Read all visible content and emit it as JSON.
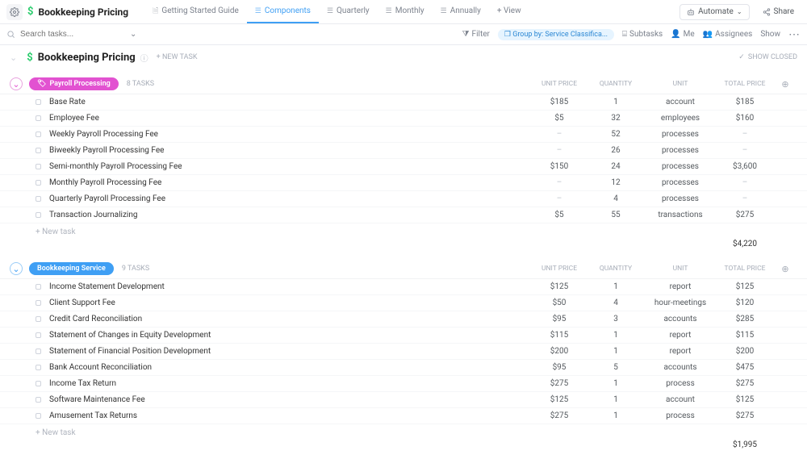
{
  "header": {
    "title": "Bookkeeping Pricing",
    "tabs": [
      {
        "label": "Getting Started Guide",
        "active": false
      },
      {
        "label": "Components",
        "active": true
      },
      {
        "label": "Quarterly",
        "active": false
      },
      {
        "label": "Monthly",
        "active": false
      },
      {
        "label": "Annually",
        "active": false
      }
    ],
    "addView": "+ View",
    "automate": "Automate",
    "share": "Share"
  },
  "toolbar": {
    "searchPlaceholder": "Search tasks...",
    "filter": "Filter",
    "groupBy": "Group by: Service Classifica...",
    "subtasks": "Subtasks",
    "me": "Me",
    "assignees": "Assignees",
    "show": "Show"
  },
  "list": {
    "title": "Bookkeeping Pricing",
    "newTask": "+ NEW TASK",
    "showClosed": "SHOW CLOSED"
  },
  "columns": {
    "c1": "UNIT PRICE",
    "c2": "QUANTITY",
    "c3": "UNIT",
    "c4": "TOTAL PRICE"
  },
  "groups": [
    {
      "color": "pink",
      "name": "Payroll Processing",
      "count": "8 TASKS",
      "subtotal": "$4,220",
      "tasks": [
        {
          "name": "Base Rate",
          "unitPrice": "$185",
          "qty": "1",
          "unit": "account",
          "total": "$185"
        },
        {
          "name": "Employee Fee",
          "unitPrice": "$5",
          "qty": "32",
          "unit": "employees",
          "total": "$160"
        },
        {
          "name": "Weekly Payroll Processing Fee",
          "unitPrice": "–",
          "qty": "52",
          "unit": "processes",
          "total": "–"
        },
        {
          "name": "Biweekly Payroll Processing Fee",
          "unitPrice": "–",
          "qty": "26",
          "unit": "processes",
          "total": "–"
        },
        {
          "name": "Semi-monthly Payroll Processing Fee",
          "unitPrice": "$150",
          "qty": "24",
          "unit": "processes",
          "total": "$3,600"
        },
        {
          "name": "Monthly Payroll Processing Fee",
          "unitPrice": "–",
          "qty": "12",
          "unit": "processes",
          "total": "–"
        },
        {
          "name": "Quarterly Payroll Processing Fee",
          "unitPrice": "–",
          "qty": "4",
          "unit": "processes",
          "total": "–"
        },
        {
          "name": "Transaction Journalizing",
          "unitPrice": "$5",
          "qty": "55",
          "unit": "transactions",
          "total": "$275"
        }
      ]
    },
    {
      "color": "blue",
      "name": "Bookkeeping Service",
      "count": "9 TASKS",
      "subtotal": "$1,995",
      "tasks": [
        {
          "name": "Income Statement Development",
          "unitPrice": "$125",
          "qty": "1",
          "unit": "report",
          "total": "$125"
        },
        {
          "name": "Client Support Fee",
          "unitPrice": "$50",
          "qty": "4",
          "unit": "hour-meetings",
          "total": "$120"
        },
        {
          "name": "Credit Card Reconciliation",
          "unitPrice": "$95",
          "qty": "3",
          "unit": "accounts",
          "total": "$285"
        },
        {
          "name": "Statement of Changes in Equity Development",
          "unitPrice": "$115",
          "qty": "1",
          "unit": "report",
          "total": "$115"
        },
        {
          "name": "Statement of Financial Position Development",
          "unitPrice": "$200",
          "qty": "1",
          "unit": "report",
          "total": "$200"
        },
        {
          "name": "Bank Account Reconciliation",
          "unitPrice": "$95",
          "qty": "5",
          "unit": "accounts",
          "total": "$475"
        },
        {
          "name": "Income Tax Return",
          "unitPrice": "$275",
          "qty": "1",
          "unit": "process",
          "total": "$275"
        },
        {
          "name": "Software Maintenance Fee",
          "unitPrice": "$125",
          "qty": "1",
          "unit": "account",
          "total": "$125"
        },
        {
          "name": "Amusement Tax Returns",
          "unitPrice": "$275",
          "qty": "1",
          "unit": "process",
          "total": "$275"
        }
      ]
    }
  ],
  "misc": {
    "newTaskRow": "+ New task",
    "plus": "⊕"
  }
}
